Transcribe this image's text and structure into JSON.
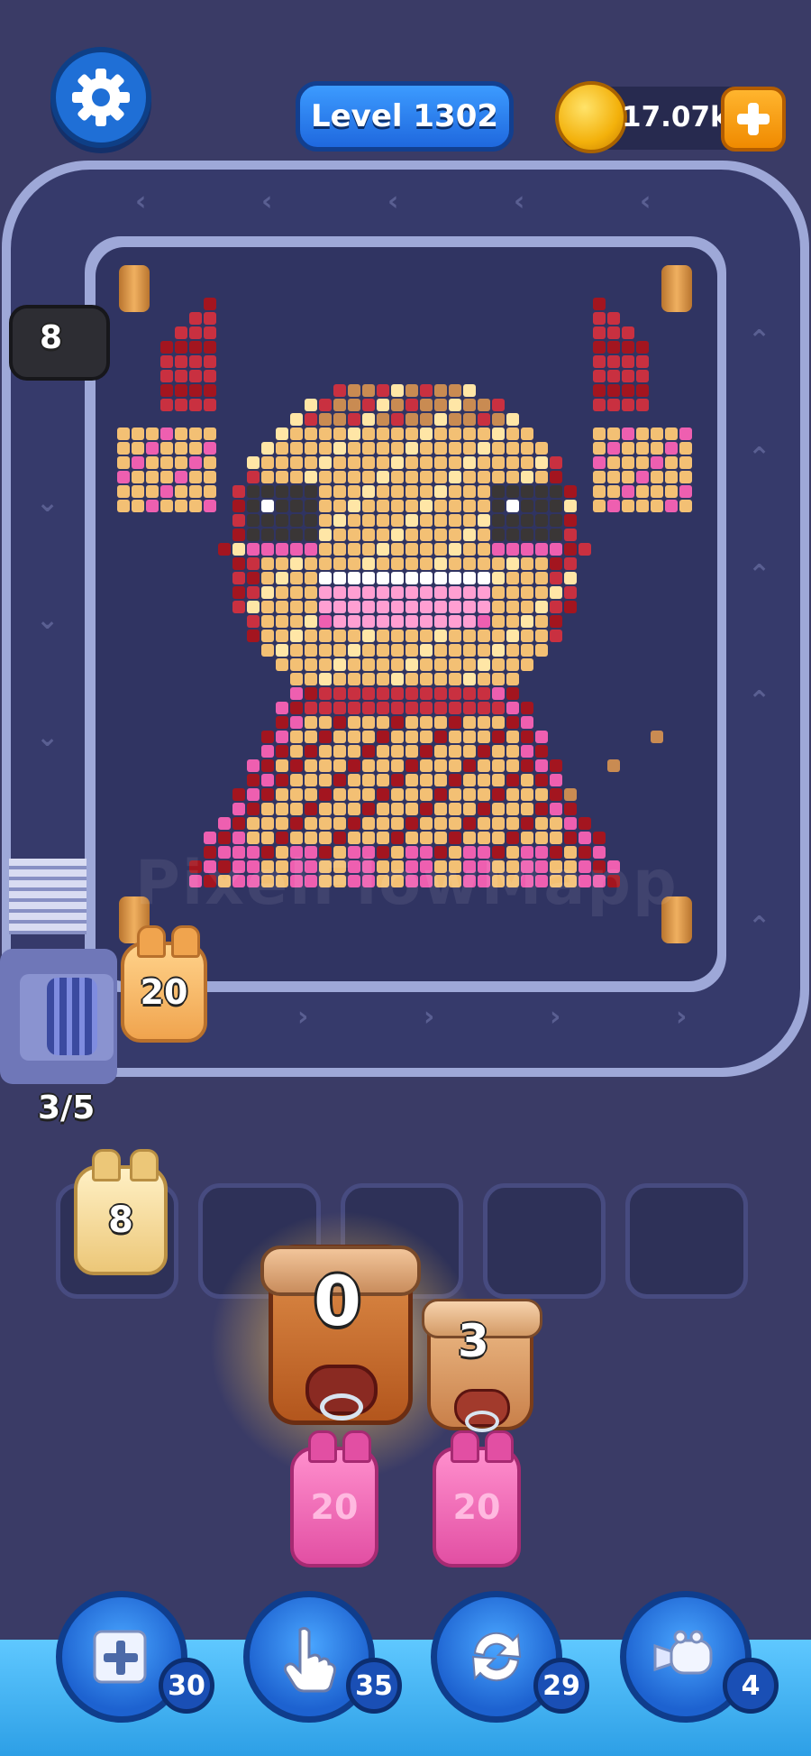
{
  "header": {
    "level_label": "Level 1302",
    "coins": "17.07k"
  },
  "board": {
    "watermark": "PixelFlowMapp"
  },
  "belt": {
    "black_piggy_count": "8",
    "orange_piggy_count": "20",
    "queue_progress": "3/5"
  },
  "slots": {
    "slot1_count": "8"
  },
  "shooters": {
    "active_count": "0",
    "second_count": "3",
    "pink_left_count": "20",
    "pink_right_count": "20"
  },
  "powerups": [
    {
      "icon": "add-slot-icon",
      "count": "30"
    },
    {
      "icon": "pointer-hand-icon",
      "count": "35"
    },
    {
      "icon": "shuffle-icon",
      "count": "29"
    },
    {
      "icon": "vacuum-icon",
      "count": "4"
    }
  ],
  "palette": {
    "accent_blue": "#1f68de",
    "coin_gold": "#f3b10b",
    "plus_orange": "#f08a00",
    "background": "#3a3b66"
  }
}
